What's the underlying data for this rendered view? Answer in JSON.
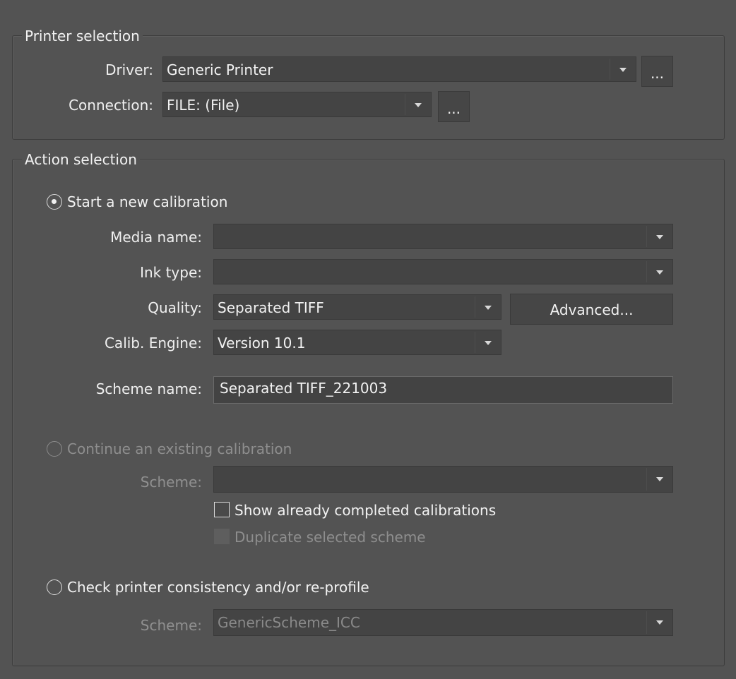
{
  "printer_selection": {
    "legend": "Printer selection",
    "driver_label": "Driver:",
    "driver_value": "Generic Printer",
    "driver_more": "...",
    "connection_label": "Connection:",
    "connection_value": "FILE: (File)",
    "connection_more": "..."
  },
  "action_selection": {
    "legend": "Action selection",
    "new_calibration": {
      "label": "Start a new calibration",
      "selected": true,
      "media_name_label": "Media name:",
      "media_name_value": "",
      "ink_type_label": "Ink type:",
      "ink_type_value": "",
      "quality_label": "Quality:",
      "quality_value": "Separated TIFF",
      "advanced_button": "Advanced...",
      "engine_label": "Calib. Engine:",
      "engine_value": "Version 10.1",
      "scheme_name_label": "Scheme name:",
      "scheme_name_value": "Separated TIFF_221003"
    },
    "continue_calibration": {
      "label": "Continue an existing calibration",
      "selected": false,
      "enabled": false,
      "scheme_label": "Scheme:",
      "scheme_value": "",
      "show_completed_label": "Show already completed calibrations",
      "show_completed_checked": false,
      "duplicate_label": "Duplicate selected scheme",
      "duplicate_checked": false
    },
    "check_consistency": {
      "label": "Check printer consistency and/or re-profile",
      "selected": false,
      "scheme_label": "Scheme:",
      "scheme_value": "GenericScheme_ICC"
    }
  }
}
